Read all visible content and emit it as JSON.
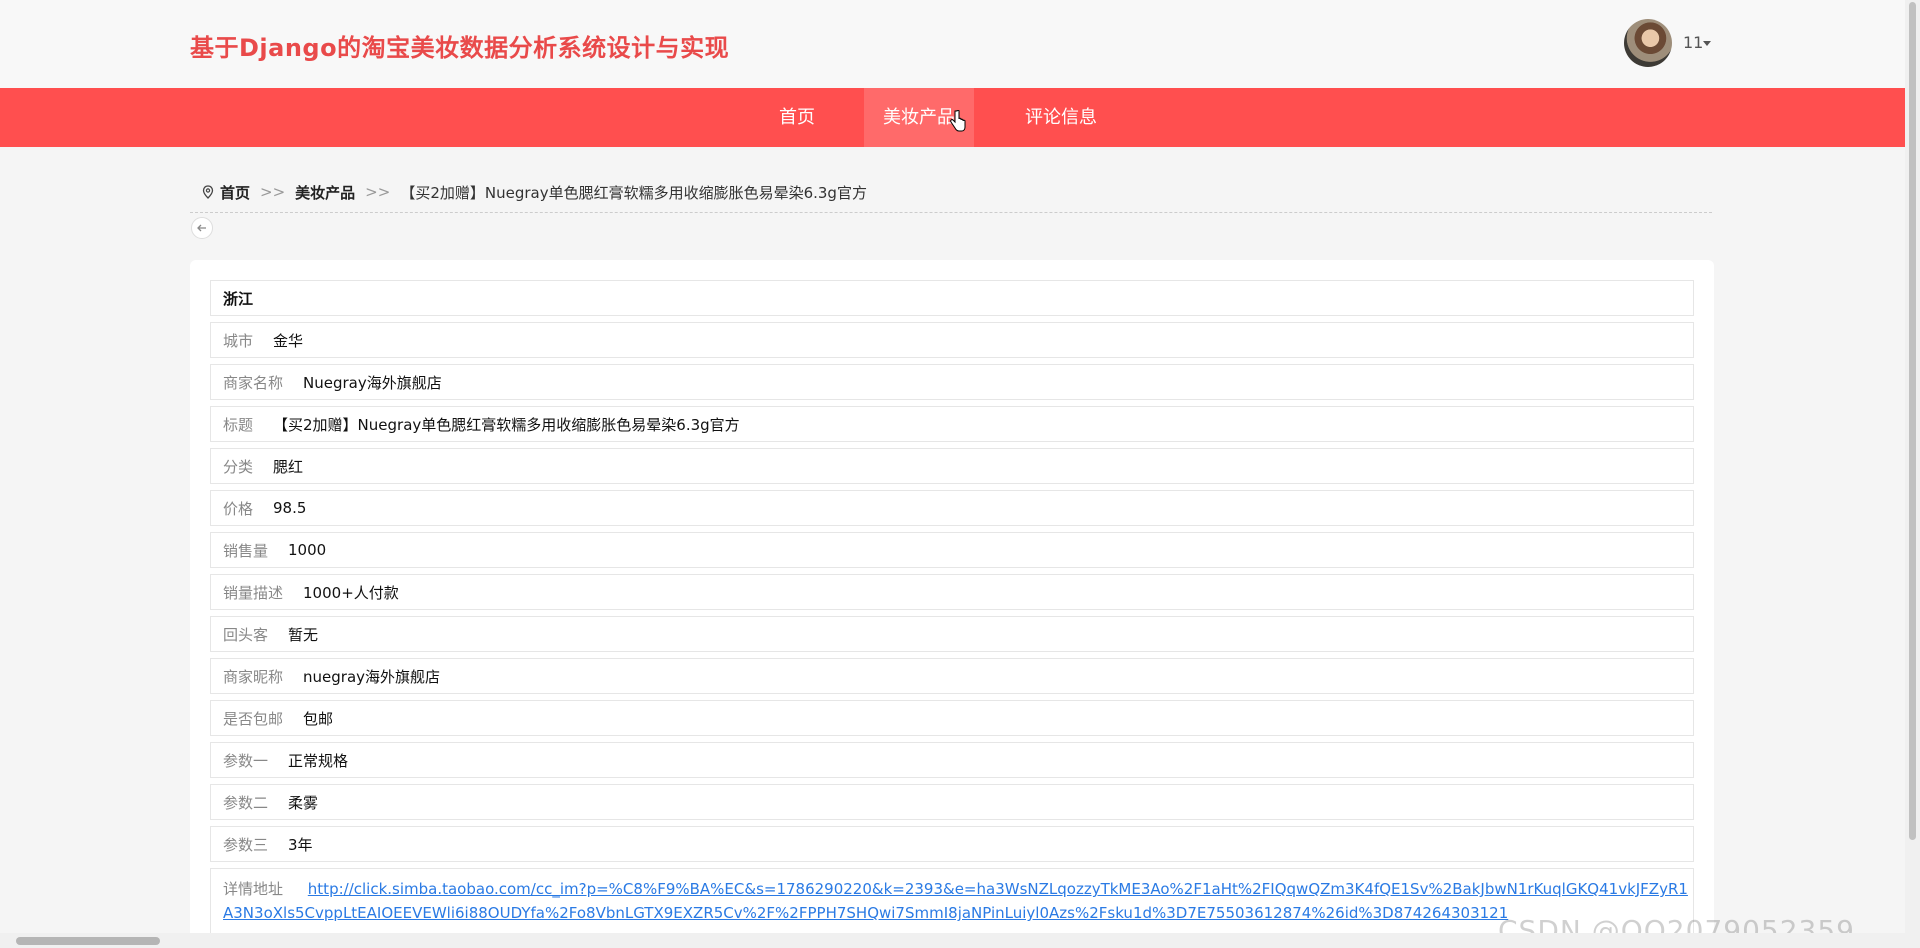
{
  "header": {
    "site_title": "基于Django的淘宝美妆数据分析系统设计与实现",
    "user_name": "11"
  },
  "nav": {
    "items": [
      {
        "label": "首页"
      },
      {
        "label": "美妆产品"
      },
      {
        "label": "评论信息"
      }
    ],
    "active_index": 1
  },
  "breadcrumb": {
    "home": "首页",
    "category": "美妆产品",
    "separator": ">>",
    "current": "【买2加赠】Nuegray单色腮红膏软糯多用收缩膨胀色易晕染6.3g官方"
  },
  "detail": {
    "province": "浙江",
    "city": {
      "label": "城市",
      "value": "金华"
    },
    "shop_name": {
      "label": "商家名称",
      "value": "Nuegray海外旗舰店"
    },
    "title": {
      "label": "标题",
      "value": "【买2加赠】Nuegray单色腮红膏软糯多用收缩膨胀色易晕染6.3g官方"
    },
    "category": {
      "label": "分类",
      "value": "腮红"
    },
    "price": {
      "label": "价格",
      "value": "98.5"
    },
    "sales": {
      "label": "销售量",
      "value": "1000"
    },
    "sales_desc": {
      "label": "销量描述",
      "value": "1000+人付款"
    },
    "repeat_customer": {
      "label": "回头客",
      "value": "暂无"
    },
    "shop_nick": {
      "label": "商家昵称",
      "value": "nuegray海外旗舰店"
    },
    "free_shipping": {
      "label": "是否包邮",
      "value": "包邮"
    },
    "param1": {
      "label": "参数一",
      "value": "正常规格"
    },
    "param2": {
      "label": "参数二",
      "value": "柔雾"
    },
    "param3": {
      "label": "参数三",
      "value": "3年"
    },
    "detail_url": {
      "label": "详情地址",
      "value": "http://click.simba.taobao.com/cc_im?p=%C8%F9%BA%EC&s=1786290220&k=2393&e=ha3WsNZLqozzyTkME3Ao%2F1aHt%2FIQqwQZm3K4fQE1Sv%2BakJbwN1rKuqlGKQ41vkJFZyR1A3N3oXls5CvppLtEAIOEEVEWli6i88OUDYfa%2Fo8VbnLGTX9EXZR5Cv%2F%2FPPH7SHQwi7SmmI8jaNPinLuiyl0Azs%2Fsku1d%3D7E75503612874%26id%3D874264303121"
    }
  },
  "watermark": "CSDN @QQ2079052359",
  "colors": {
    "brand_red": "#ff4f4f",
    "title_red": "#e94a4a",
    "link_blue": "#2a7ae4"
  }
}
